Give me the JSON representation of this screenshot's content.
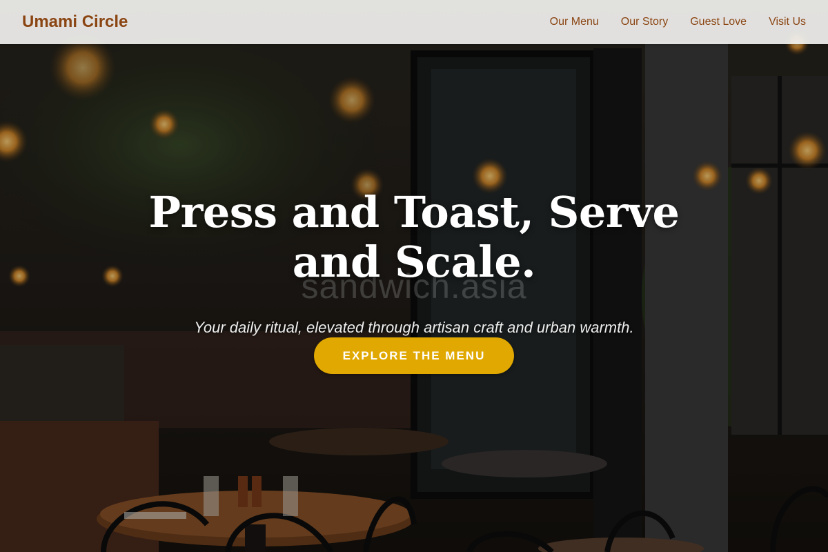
{
  "nav": {
    "brand": "Umami Circle",
    "links": [
      "Our Menu",
      "Our Story",
      "Guest Love",
      "Visit Us"
    ]
  },
  "hero": {
    "headline": "Press and Toast, Serve and Scale.",
    "watermark": "sandwich.asia",
    "tagline": "Your daily ritual, elevated through artisan craft and urban warmth.",
    "cta_label": "EXPLORE THE MENU"
  },
  "colors": {
    "brand": "#8b4513",
    "accent": "#e0a800",
    "nav_background": "#f0f0ee"
  }
}
